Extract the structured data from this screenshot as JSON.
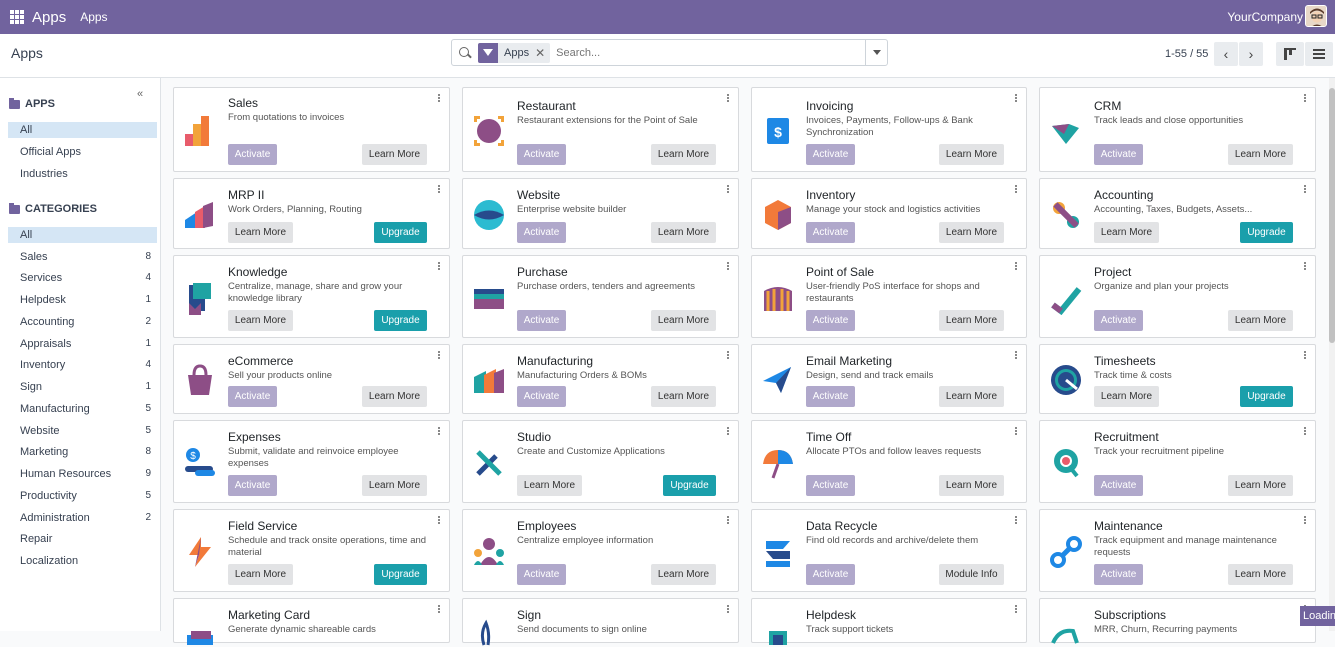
{
  "topbar": {
    "app_name": "Apps",
    "menu_apps": "Apps",
    "company": "YourCompany"
  },
  "controlbar": {
    "title": "Apps",
    "facet_label": "Apps",
    "facet_remove": "✕",
    "search_placeholder": "Search...",
    "pager": "1-55 / 55",
    "prev": "‹",
    "next": "›"
  },
  "sidebar": {
    "collapse": "«",
    "apps_title": "APPS",
    "apps_items": [
      "All",
      "Official Apps",
      "Industries"
    ],
    "categories_title": "CATEGORIES",
    "categories": [
      {
        "label": "All",
        "count": ""
      },
      {
        "label": "Sales",
        "count": "8"
      },
      {
        "label": "Services",
        "count": "4"
      },
      {
        "label": "Helpdesk",
        "count": "1"
      },
      {
        "label": "Accounting",
        "count": "2"
      },
      {
        "label": "Appraisals",
        "count": "1"
      },
      {
        "label": "Inventory",
        "count": "4"
      },
      {
        "label": "Sign",
        "count": "1"
      },
      {
        "label": "Manufacturing",
        "count": "5"
      },
      {
        "label": "Website",
        "count": "5"
      },
      {
        "label": "Marketing",
        "count": "8"
      },
      {
        "label": "Human Resources",
        "count": "9"
      },
      {
        "label": "Productivity",
        "count": "5"
      },
      {
        "label": "Administration",
        "count": "2"
      },
      {
        "label": "Repair",
        "count": ""
      },
      {
        "label": "Localization",
        "count": ""
      }
    ]
  },
  "cards": [
    {
      "name": "Sales",
      "desc": "From quotations to invoices",
      "left": "Activate",
      "right": "Learn More"
    },
    {
      "name": "Restaurant",
      "desc": "Restaurant extensions for the Point of Sale",
      "left": "Activate",
      "right": "Learn More"
    },
    {
      "name": "Invoicing",
      "desc": "Invoices, Payments, Follow-ups & Bank Synchronization",
      "left": "Activate",
      "right": "Learn More"
    },
    {
      "name": "CRM",
      "desc": "Track leads and close opportunities",
      "left": "Activate",
      "right": "Learn More"
    },
    {
      "name": "MRP II",
      "desc": "Work Orders, Planning, Routing",
      "left": "Learn More",
      "right": "Upgrade"
    },
    {
      "name": "Website",
      "desc": "Enterprise website builder",
      "left": "Activate",
      "right": "Learn More"
    },
    {
      "name": "Inventory",
      "desc": "Manage your stock and logistics activities",
      "left": "Activate",
      "right": "Learn More"
    },
    {
      "name": "Accounting",
      "desc": "Accounting, Taxes, Budgets, Assets...",
      "left": "Learn More",
      "right": "Upgrade"
    },
    {
      "name": "Knowledge",
      "desc": "Centralize, manage, share and grow your knowledge library",
      "left": "Learn More",
      "right": "Upgrade"
    },
    {
      "name": "Purchase",
      "desc": "Purchase orders, tenders and agreements",
      "left": "Activate",
      "right": "Learn More"
    },
    {
      "name": "Point of Sale",
      "desc": "User-friendly PoS interface for shops and restaurants",
      "left": "Activate",
      "right": "Learn More"
    },
    {
      "name": "Project",
      "desc": "Organize and plan your projects",
      "left": "Activate",
      "right": "Learn More"
    },
    {
      "name": "eCommerce",
      "desc": "Sell your products online",
      "left": "Activate",
      "right": "Learn More"
    },
    {
      "name": "Manufacturing",
      "desc": "Manufacturing Orders & BOMs",
      "left": "Activate",
      "right": "Learn More"
    },
    {
      "name": "Email Marketing",
      "desc": "Design, send and track emails",
      "left": "Activate",
      "right": "Learn More"
    },
    {
      "name": "Timesheets",
      "desc": "Track time & costs",
      "left": "Learn More",
      "right": "Upgrade"
    },
    {
      "name": "Expenses",
      "desc": "Submit, validate and reinvoice employee expenses",
      "left": "Activate",
      "right": "Learn More"
    },
    {
      "name": "Studio",
      "desc": "Create and Customize Applications",
      "left": "Learn More",
      "right": "Upgrade"
    },
    {
      "name": "Time Off",
      "desc": "Allocate PTOs and follow leaves requests",
      "left": "Activate",
      "right": "Learn More"
    },
    {
      "name": "Recruitment",
      "desc": "Track your recruitment pipeline",
      "left": "Activate",
      "right": "Learn More"
    },
    {
      "name": "Field Service",
      "desc": "Schedule and track onsite operations, time and material",
      "left": "Learn More",
      "right": "Upgrade"
    },
    {
      "name": "Employees",
      "desc": "Centralize employee information",
      "left": "Activate",
      "right": "Learn More"
    },
    {
      "name": "Data Recycle",
      "desc": "Find old records and archive/delete them",
      "left": "Activate",
      "right": "Module Info"
    },
    {
      "name": "Maintenance",
      "desc": "Track equipment and manage maintenance requests",
      "left": "Activate",
      "right": "Learn More"
    },
    {
      "name": "Marketing Card",
      "desc": "Generate dynamic shareable cards",
      "left": "",
      "right": ""
    },
    {
      "name": "Sign",
      "desc": "Send documents to sign online",
      "left": "",
      "right": ""
    },
    {
      "name": "Helpdesk",
      "desc": "Track support tickets",
      "left": "",
      "right": ""
    },
    {
      "name": "Subscriptions",
      "desc": "MRR, Churn, Recurring payments",
      "left": "",
      "right": ""
    }
  ],
  "loading": "Loading"
}
